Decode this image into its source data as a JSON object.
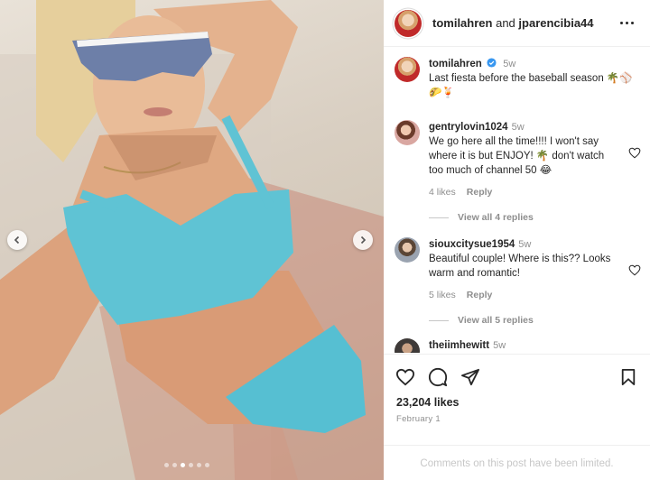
{
  "header": {
    "user1": "tomilahren",
    "conjunction": "and",
    "user2": "jparencibia44"
  },
  "caption": {
    "username": "tomilahren",
    "time": "5w",
    "text": "Last fiesta before the baseball season 🌴⚾🌮🍹"
  },
  "comments": [
    {
      "username": "gentrylovin1024",
      "time": "5w",
      "text": "We go here all the time!!!! I won't say where it is but ENJOY! 🌴 don't watch too much of channel 50 😂",
      "likes": "4 likes",
      "reply": "Reply",
      "view_replies": "View all 4 replies"
    },
    {
      "username": "siouxcitysue1954",
      "time": "5w",
      "text": "Beautiful couple! Where is this?? Looks warm and romantic!",
      "likes": "5 likes",
      "reply": "Reply",
      "view_replies": "View all 5 replies"
    },
    {
      "username": "theiimhewitt",
      "time": "5w"
    }
  ],
  "post": {
    "likes": "23,204 likes",
    "date": "February 1",
    "comments_limited": "Comments on this post have been limited."
  },
  "carousel": {
    "slide_count": 6,
    "active_index": 2
  },
  "icons": [
    "more-icon",
    "verified-icon",
    "heart-icon",
    "comment-icon",
    "share-icon",
    "bookmark-icon",
    "chevron-left-icon",
    "chevron-right-icon"
  ],
  "colors": {
    "verified": "#3897f0",
    "muted": "#8e8e8e",
    "bikini": "#5fc3d4"
  }
}
